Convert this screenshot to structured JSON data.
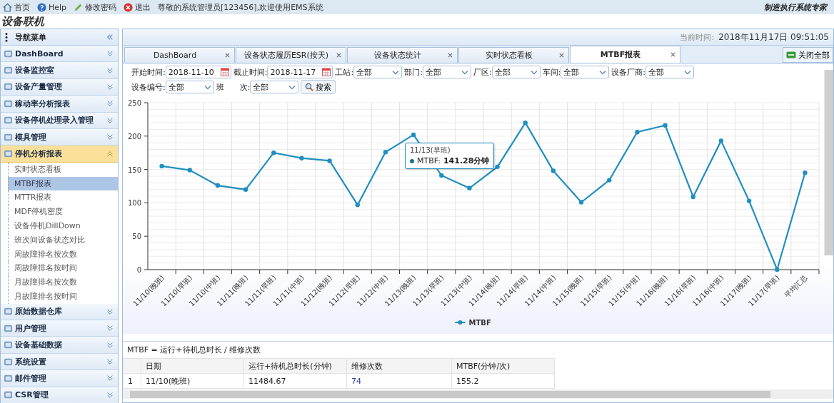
{
  "top_bar": {
    "links": [
      {
        "label": "首页",
        "kind": "home"
      },
      {
        "label": "Help",
        "kind": "help"
      },
      {
        "label": "修改密码",
        "kind": "edit"
      },
      {
        "label": "退出",
        "kind": "exit"
      }
    ],
    "welcome": "尊敬的系统管理员[123456],欢迎使用EMS系统",
    "slogan": "制造执行系统专家"
  },
  "app_title": "设备联机",
  "sidebar": {
    "title": "导航菜单",
    "sections": [
      {
        "label": "DashBoard",
        "expanded": false
      },
      {
        "label": "设备监控室",
        "expanded": false
      },
      {
        "label": "设备产量管理",
        "expanded": false
      },
      {
        "label": "稼动率分析报表",
        "expanded": false
      },
      {
        "label": "设备停机处理录入管理",
        "expanded": false
      },
      {
        "label": "模具管理",
        "expanded": false
      },
      {
        "label": "停机分析报表",
        "expanded": true,
        "children": [
          {
            "label": "实时状态看板",
            "selected": false
          },
          {
            "label": "MTBF报表",
            "selected": true
          },
          {
            "label": "MTTR报表",
            "selected": false
          },
          {
            "label": "MDF停机密度",
            "selected": false
          },
          {
            "label": "设备停机DillDown",
            "selected": false
          },
          {
            "label": "班次间设备状态对比",
            "selected": false
          },
          {
            "label": "周故障排名按次数",
            "selected": false
          },
          {
            "label": "周故障排名按时间",
            "selected": false
          },
          {
            "label": "月故障排名按次数",
            "selected": false
          },
          {
            "label": "月故障排名按时间",
            "selected": false
          }
        ]
      },
      {
        "label": "原始数据仓库",
        "expanded": false
      },
      {
        "label": "用户管理",
        "expanded": false
      },
      {
        "label": "设备基础数据",
        "expanded": false
      },
      {
        "label": "系统设置",
        "expanded": false
      },
      {
        "label": "邮件管理",
        "expanded": false
      },
      {
        "label": "CSR管理",
        "expanded": false
      }
    ]
  },
  "header": {
    "time_label": "当前时间:",
    "time_value": "2018年11月17日 09:51:05"
  },
  "tabs": [
    {
      "label": "DashBoard",
      "selected": false
    },
    {
      "label": "设备状态履历ESR(按天)",
      "selected": false
    },
    {
      "label": "设备状态统计",
      "selected": false
    },
    {
      "label": "实时状态看板",
      "selected": false
    },
    {
      "label": "MTBF报表",
      "selected": true
    }
  ],
  "close_all": "关闭全部",
  "filters": [
    {
      "label": "开始时间:",
      "value": "2018-11-10",
      "kind": "date"
    },
    {
      "label": "截止时间:",
      "value": "2018-11-17",
      "kind": "date"
    },
    {
      "label": "工站:",
      "value": "全部",
      "kind": "select"
    },
    {
      "label": "部门:",
      "value": "全部",
      "kind": "select"
    },
    {
      "label": "厂区:",
      "value": "全部",
      "kind": "select"
    },
    {
      "label": "车间:",
      "value": "全部",
      "kind": "select"
    },
    {
      "label": "设备厂商:",
      "value": "全部",
      "kind": "select"
    },
    {
      "label": "设备编号:",
      "value": "全部",
      "kind": "select"
    },
    {
      "label": "班　　次:",
      "value": "全部",
      "kind": "select"
    }
  ],
  "search_button": "搜索",
  "chart_data": {
    "type": "line",
    "categories": [
      "11/10(晚班)",
      "11/10(早班)",
      "11/10(中班)",
      "11/11(晚班)",
      "11/11(早班)",
      "11/11(中班)",
      "11/12(晚班)",
      "11/12(早班)",
      "11/12(中班)",
      "11/13(晚班)",
      "11/13(早班)",
      "11/13(中班)",
      "11/14(晚班)",
      "11/14(早班)",
      "11/14(中班)",
      "11/15(晚班)",
      "11/15(早班)",
      "11/15(中班)",
      "11/16(晚班)",
      "11/16(早班)",
      "11/16(中班)",
      "11/17(晚班)",
      "11/17(早班)",
      "平均汇总"
    ],
    "grid": true,
    "series": [
      {
        "name": "MTBF",
        "color": "#1f8fbf",
        "marker": "circle",
        "values": [
          155,
          149,
          126,
          120,
          175,
          167,
          163,
          97,
          176,
          202,
          141,
          122,
          154,
          220,
          148,
          101,
          134,
          206,
          216,
          109,
          193,
          103,
          0,
          145
        ]
      }
    ],
    "ylim": [
      0,
      250
    ],
    "yticks": [
      0,
      50,
      100,
      150,
      200,
      250
    ]
  },
  "tooltip": {
    "title": "11/13(早班)",
    "series": "MTBF:",
    "value": "141.28分钟"
  },
  "formula": "MTBF = 运行+待机总时长 / 维修次数",
  "table": {
    "columns": [
      "日期",
      "运行+待机总时长(分钟)",
      "维修次数",
      "MTBF(分钟/次)"
    ],
    "rows": [
      {
        "index": "1",
        "cells": [
          "11/10(晚班)",
          "11484.67",
          "74",
          "155.2"
        ]
      }
    ]
  }
}
